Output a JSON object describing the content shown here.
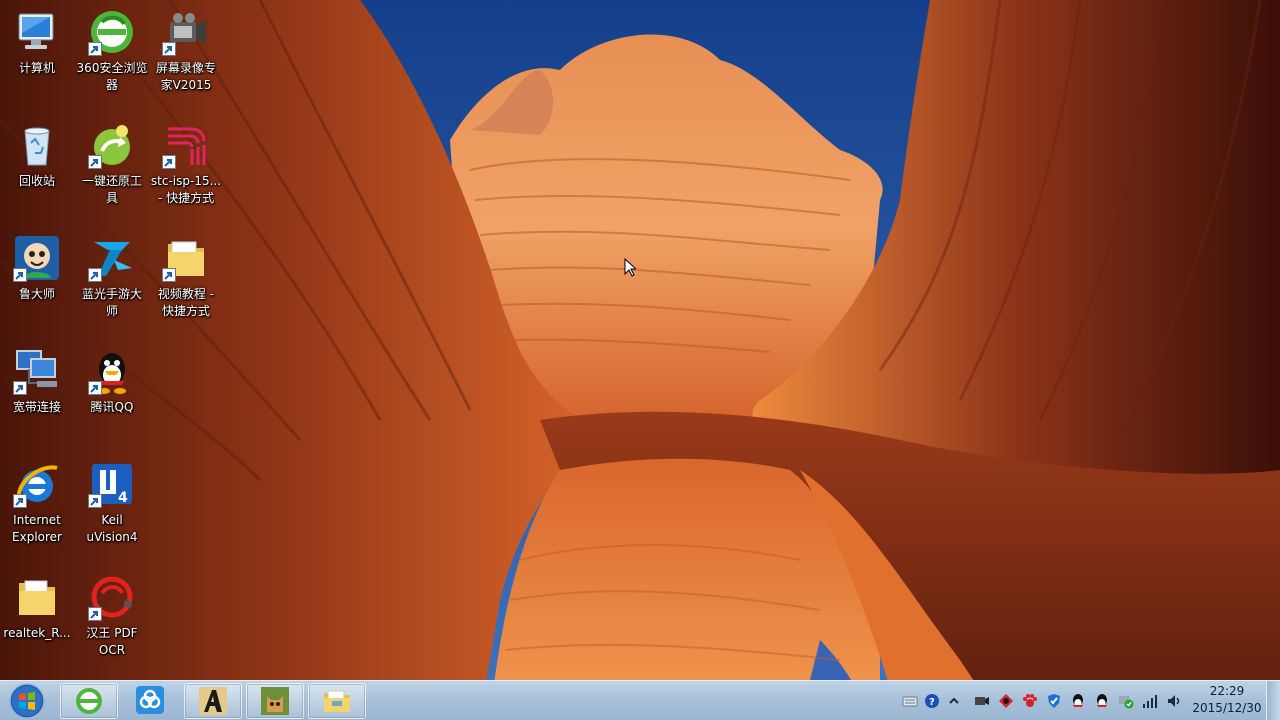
{
  "desktop": {
    "icons": [
      {
        "label": "计算机",
        "icon": "computer-icon",
        "shortcut": false
      },
      {
        "label": "360安全浏览\n器",
        "icon": "360-browser-icon",
        "shortcut": true
      },
      {
        "label": "屏幕录像专\n家V2015",
        "icon": "screen-recorder-icon",
        "shortcut": true
      },
      {
        "label": "回收站",
        "icon": "recycle-bin-icon",
        "shortcut": false
      },
      {
        "label": "一键还原工\n具",
        "icon": "restore-tool-icon",
        "shortcut": true
      },
      {
        "label": "stc-isp-15...\n- 快捷方式",
        "icon": "stc-isp-icon",
        "shortcut": true
      },
      {
        "label": "鲁大师",
        "icon": "ludashi-icon",
        "shortcut": true
      },
      {
        "label": "蓝光手游大\n师",
        "icon": "mobile-game-master-icon",
        "shortcut": true
      },
      {
        "label": "视频教程 -\n快捷方式",
        "icon": "folder-icon",
        "shortcut": true
      },
      {
        "label": "宽带连接",
        "icon": "broadband-connection-icon",
        "shortcut": true
      },
      {
        "label": "腾讯QQ",
        "icon": "qq-icon",
        "shortcut": true
      },
      {
        "label": "Internet\nExplorer",
        "icon": "internet-explorer-icon",
        "shortcut": true
      },
      {
        "label": "Keil\nuVision4",
        "icon": "keil-icon",
        "shortcut": true
      },
      {
        "label": "realtek_R...",
        "icon": "folder-icon",
        "shortcut": false
      },
      {
        "label": "汉王 PDF\nOCR",
        "icon": "hanwang-ocr-icon",
        "shortcut": true
      }
    ]
  },
  "taskbar": {
    "start": {
      "icon": "windows-start-icon"
    },
    "items": [
      {
        "icon": "360-browser-icon"
      },
      {
        "icon": "baidu-cloud-icon"
      },
      {
        "icon": "altium-designer-icon"
      },
      {
        "icon": "cat-photo-app-icon"
      },
      {
        "icon": "file-explorer-icon"
      }
    ],
    "tray": [
      {
        "icon": "keyboard-icon"
      },
      {
        "icon": "help-icon"
      },
      {
        "icon": "show-hidden-icons-icon"
      },
      {
        "icon": "recorder-tray-icon"
      },
      {
        "icon": "security-tray-icon"
      },
      {
        "icon": "paw-tray-icon"
      },
      {
        "icon": "shield-tray-icon"
      },
      {
        "icon": "qq-tray-icon"
      },
      {
        "icon": "qq-tray-icon-2"
      },
      {
        "icon": "network-secure-icon"
      },
      {
        "icon": "signal-icon"
      },
      {
        "icon": "volume-icon"
      }
    ],
    "clock": {
      "time": "22:29",
      "date": "2015/12/30"
    }
  },
  "colors": {
    "taskbar": "#a7c0d9",
    "sky": "#1f4f97",
    "rock": "#c8582a"
  }
}
